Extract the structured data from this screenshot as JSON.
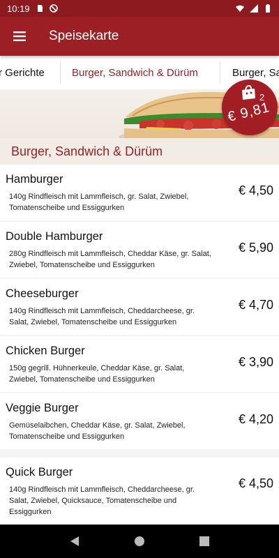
{
  "status_bar": {
    "time": "10:19"
  },
  "app_bar": {
    "title": "Speisekarte"
  },
  "tabs": [
    {
      "label": "r Gerichte"
    },
    {
      "label": "Burger, Sandwich & Dürüm"
    },
    {
      "label": "Burger, Sa"
    }
  ],
  "cart": {
    "count": "2",
    "total": "€ 9,81"
  },
  "section": {
    "title": "Burger, Sandwich & Dürüm"
  },
  "items": [
    {
      "name": "Hamburger",
      "description": "140g Rindfleisch mit Lammfleisch, gr. Salat, Zwiebel, Tomatenscheibe und Essiggurken",
      "price": "€ 4,50"
    },
    {
      "name": "Double Hamburger",
      "description": "280g Rindfleisch mit Lammfleisch, Cheddar Käse, gr. Salat, Zwiebel, Tomatenscheibe und Essiggurken",
      "price": "€ 5,90"
    },
    {
      "name": "Cheeseburger",
      "description": "140g Rindfleisch mit Lammfleisch, Cheddarcheese, gr. Salat, Zwiebel, Tomatenscheibe und Essiggurken",
      "price": "€ 4,70"
    },
    {
      "name": "Chicken Burger",
      "description": "150g gegrill. Hühnerkeule, Cheddar Käse, gr. Salat, Zwiebel, Tomatenscheibe und Essiggurken",
      "price": "€ 3,90"
    },
    {
      "name": "Veggie Burger",
      "description": "Gemüselaibchen, Cheddar Käse, gr. Salat, Zwiebel, Tomatenscheibe und Essiggurken",
      "price": "€ 4,20"
    },
    {
      "name": "Quick Burger",
      "description": "140g Rindfleisch mit Lammfleisch, Cheddarcheese, gr. Salat, Zwiebel, Quicksauce, Tomatenscheibe und Essiggurken",
      "price": "€ 4,50"
    }
  ],
  "colors": {
    "primary": "#9b1f24",
    "status_bar": "#8c1a1e",
    "section_bg": "#f1ece6"
  },
  "icons": {
    "status": [
      "sim-card-icon",
      "do-not-disturb-icon",
      "wifi-icon",
      "signal-icon",
      "battery-icon"
    ],
    "menu": "hamburger-menu-icon",
    "cart": "shopping-bag-icon",
    "nav": [
      "back-icon",
      "home-icon",
      "recents-icon"
    ]
  }
}
